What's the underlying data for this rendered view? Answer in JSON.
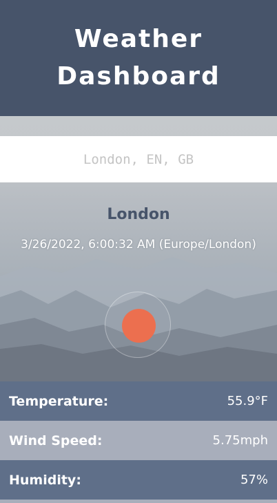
{
  "header": {
    "title": "Weather Dashboard"
  },
  "search": {
    "placeholder": "London, EN, GB"
  },
  "current": {
    "city": "London",
    "datetime": "3/26/2022, 6:00:32 AM (Europe/London)",
    "icon": "sun-icon"
  },
  "stats": [
    {
      "label": "Temperature:",
      "value": "55.9°F"
    },
    {
      "label": "Wind Speed:",
      "value": "5.75mph"
    },
    {
      "label": "Humidity:",
      "value": "57%"
    }
  ],
  "colors": {
    "header_bg": "#47546a",
    "row_dark": "#5f6f89",
    "row_light": "#a8aebb",
    "sun": "#ec6f4f",
    "city_text": "#47546a"
  }
}
